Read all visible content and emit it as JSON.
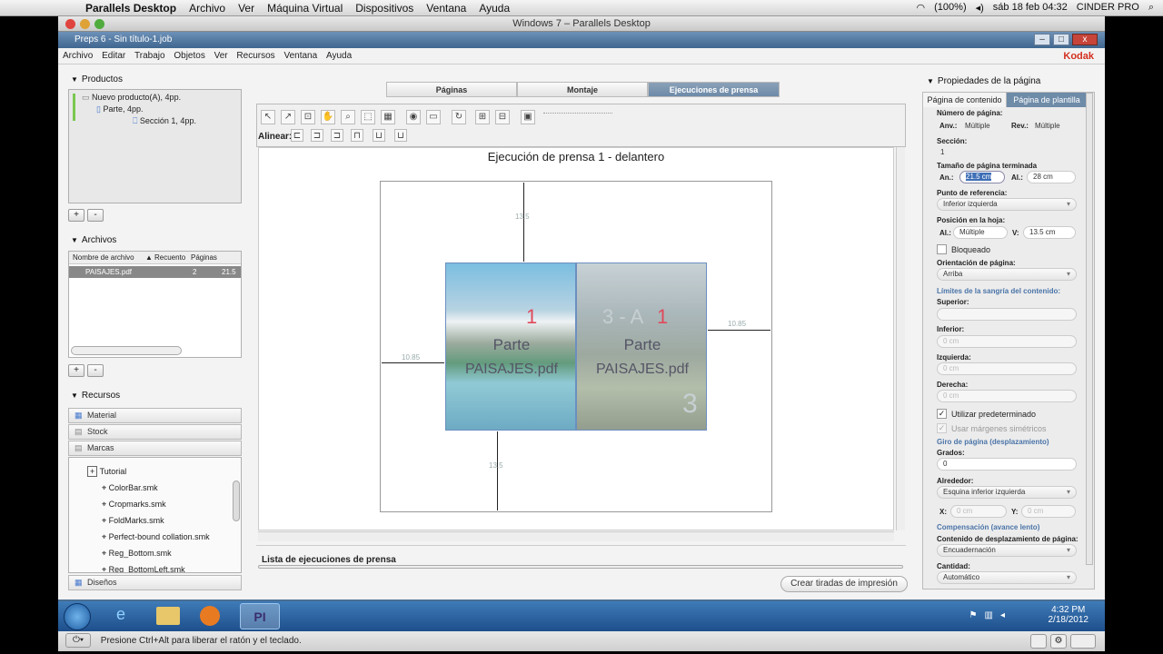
{
  "macbar": {
    "app": "Parallels Desktop",
    "menus": [
      "Archivo",
      "Ver",
      "Máquina Virtual",
      "Dispositivos",
      "Ventana",
      "Ayuda"
    ],
    "battery": "(100%)",
    "datetime": "sáb 18 feb  04:32",
    "user": "CINDER PRO"
  },
  "parallels_title": "Windows 7 – Parallels Desktop",
  "window": {
    "title": "Preps 6 - Sin título-1.job",
    "menus": [
      "Archivo",
      "Editar",
      "Trabajo",
      "Objetos",
      "Ver",
      "Recursos",
      "Ventana",
      "Ayuda"
    ],
    "brand": "Kodak"
  },
  "productos": {
    "header": "Productos",
    "tree": [
      "Nuevo producto(A), 4pp.",
      "Parte, 4pp.",
      "Sección 1, 4pp."
    ]
  },
  "archivos": {
    "header": "Archivos",
    "columns": [
      "Nombre de archivo",
      "Recuento",
      "Páginas"
    ],
    "rows": [
      {
        "name": "PAISAJES.pdf",
        "count": "2",
        "pages": "21.5"
      }
    ]
  },
  "recursos": {
    "header": "Recursos",
    "categories": [
      "Material",
      "Stock",
      "Marcas"
    ],
    "tree_folder": "Tutorial",
    "files": [
      "ColorBar.smk",
      "Cropmarks.smk",
      "FoldMarks.smk",
      "Perfect-bound collation.smk",
      "Reg_Bottom.smk",
      "Reg_BottomLeft.smk"
    ],
    "bottom": "Diseños"
  },
  "center": {
    "tabs": [
      "Páginas",
      "Montaje",
      "Ejecuciones de prensa"
    ],
    "align_label": "Alinear:",
    "sheet_title": "Ejecución de prensa 1 - delantero",
    "dim_top": "13.5",
    "dim_bottom": "13.5",
    "dim_left": "10.85",
    "dim_right": "10.85",
    "page1": {
      "num": "1",
      "part": "Parte",
      "file": "PAISAJES.pdf"
    },
    "page2": {
      "prefix": "3 - A",
      "num": "1",
      "part": "Parte",
      "file": "PAISAJES.pdf",
      "corner": "3"
    },
    "list_label": "Lista de ejecuciones de prensa",
    "create_button": "Crear tiradas de impresión"
  },
  "props": {
    "header": "Propiedades de la página",
    "tabs": [
      "Página de contenido",
      "Página de plantilla"
    ],
    "numero_label": "Número de página:",
    "anv_label": "Anv.:",
    "anv_val": "Múltiple",
    "rev_label": "Rev.:",
    "rev_val": "Múltiple",
    "seccion_label": "Sección:",
    "seccion_val": "1",
    "tamano_label": "Tamaño de página terminada",
    "an_label": "An.:",
    "an_val": "21.5 cm",
    "al_label": "Al.:",
    "al_val": "28 cm",
    "punto_label": "Punto de referencia:",
    "punto_val": "Inferior izquierda",
    "pos_label": "Posición en la hoja:",
    "pos_al_label": "Al.:",
    "pos_al_val": "Múltiple",
    "pos_v_label": "V:",
    "pos_v_val": "13.5 cm",
    "bloqueado": "Bloqueado",
    "orient_label": "Orientación de página:",
    "orient_val": "Arriba",
    "sangria_section": "Límites de la sangría del contenido:",
    "superior": "Superior:",
    "inferior": "Inferior:",
    "inferior_val": "0 cm",
    "izquierda": "Izquierda:",
    "izquierda_val": "0 cm",
    "derecha": "Derecha:",
    "derecha_val": "0 cm",
    "utilizar": "Utilizar predeterminado",
    "simetricos": "Usar márgenes simétricos",
    "giro_section": "Giro de página (desplazamiento)",
    "grados_label": "Grados:",
    "grados_val": "0",
    "alrededor_label": "Alrededor:",
    "alrededor_val": "Esquina inferior izquierda",
    "x_label": "X:",
    "x_val": "0 cm",
    "y_label": "Y:",
    "y_val": "0 cm",
    "comp_section": "Compensación (avance lento)",
    "contenido_label": "Contenido de desplazamiento de página:",
    "contenido_val": "Encuadernación",
    "cantidad_label": "Cantidad:",
    "cantidad_val": "Automático"
  },
  "taskbar": {
    "time": "4:32 PM",
    "date": "2/18/2012"
  },
  "status": "Presione Ctrl+Alt para liberar el ratón y el teclado."
}
